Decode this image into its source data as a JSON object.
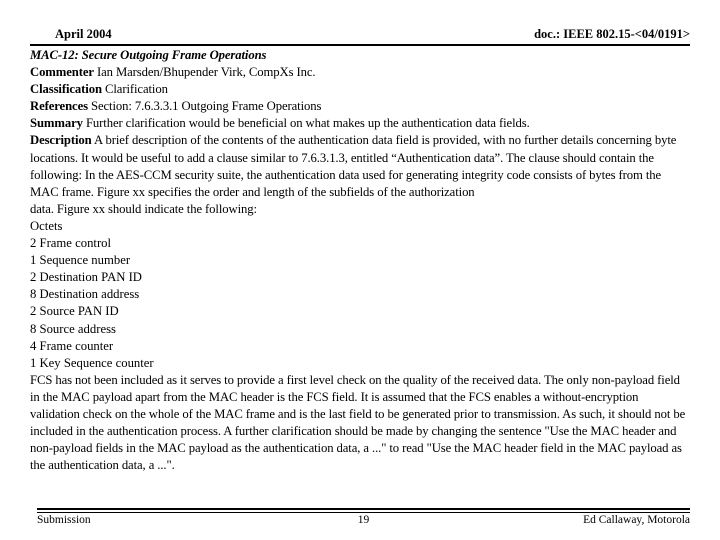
{
  "header": {
    "date": "April 2004",
    "doc_ref": "doc.: IEEE 802.15-<04/0191>"
  },
  "document": {
    "title": "MAC-12: Secure Outgoing Frame Operations",
    "fields": [
      {
        "label": "Commenter",
        "value": " Ian Marsden/Bhupender Virk, CompXs Inc."
      },
      {
        "label": "Classification",
        "value": " Clarification"
      },
      {
        "label": "References",
        "value": " Section: 7.6.3.3.1 Outgoing Frame Operations"
      }
    ],
    "summary_label": "Summary",
    "summary_text": " Further clarification would be beneficial on what makes up the authentication data fields.",
    "description_label": "Description",
    "description_text": " A brief description of the contents of the authentication data field is provided, with no further details concerning byte locations. It would be useful to add a clause similar to 7.6.3.1.3, entitled “Authentication data”. The clause should contain the following: In the AES-CCM security suite, the authentication data used for generating integrity code consists of bytes from the MAC frame. Figure xx specifies the order and length of the subfields of the authorization",
    "description_continued": "data. Figure xx should indicate the following:",
    "octets_heading": "Octets",
    "octets": [
      "2 Frame control",
      "1 Sequence number",
      "2 Destination PAN ID",
      "8 Destination address",
      "2 Source PAN ID",
      "8 Source address",
      "4 Frame counter",
      "1 Key Sequence counter"
    ],
    "closing_paragraph": "FCS has not been included as it serves to provide a first level check on the quality of the received data. The only non-payload field in the MAC payload apart from the MAC header is the FCS field. It is assumed that the FCS enables a without-encryption validation check on the whole of the MAC frame and is the last field to be generated prior to transmission. As such, it should not be included in the authentication process. A further clarification should be made by changing the sentence \"Use the MAC header and non-payload fields in the MAC payload as the authentication data, a ...\" to read \"Use the MAC header field in the MAC payload as the authentication data, a ...\"."
  },
  "footer": {
    "left": "Submission",
    "page_number": "19",
    "right": "Ed Callaway, Motorola"
  }
}
